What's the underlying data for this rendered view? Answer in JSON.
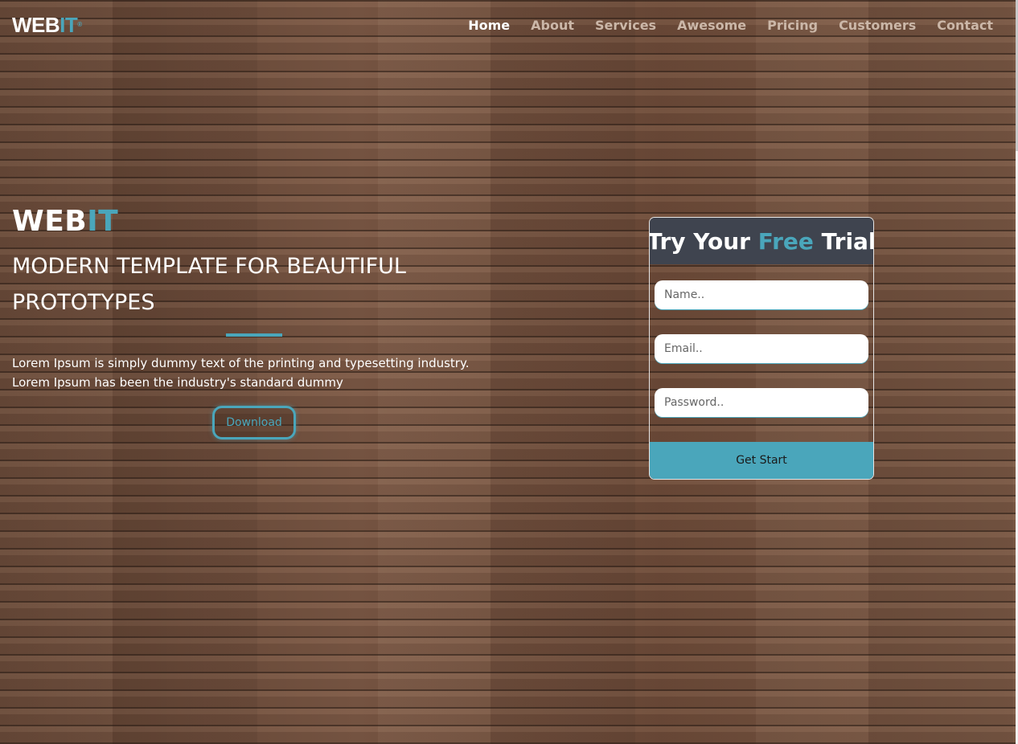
{
  "brand": {
    "logo_main": "WEB",
    "logo_accent": "IT",
    "logo_mark": "®"
  },
  "nav": {
    "items": [
      {
        "label": "Home",
        "active": true
      },
      {
        "label": "About",
        "active": false
      },
      {
        "label": "Services",
        "active": false
      },
      {
        "label": "Awesome",
        "active": false
      },
      {
        "label": "Pricing",
        "active": false
      },
      {
        "label": "Customers",
        "active": false
      },
      {
        "label": "Contact",
        "active": false
      }
    ]
  },
  "hero": {
    "title_main": "WEB",
    "title_accent": "IT",
    "subtitle": "MODERN TEMPLATE FOR BEAUTIFUL PROTOTYPES",
    "text": "Lorem Ipsum is simply dummy text of the printing and typesetting industry. Lorem Ipsum has been the industry's standard dummy",
    "download_label": "Download"
  },
  "trial": {
    "title_before": "Try Your ",
    "title_accent": "Free",
    "title_after": " Trial",
    "name_placeholder": "Name..",
    "email_placeholder": "Email..",
    "password_placeholder": "Password..",
    "submit_label": "Get Start"
  },
  "colors": {
    "accent": "#4aa6bb",
    "card_header": "#3f444f",
    "nav_inactive": "#cbb7a8",
    "text_light": "#ffffff"
  }
}
